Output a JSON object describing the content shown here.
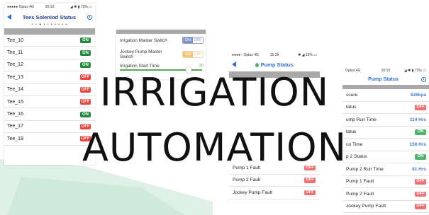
{
  "colors": {
    "on": "#1e8b3a",
    "off": "#f0423c",
    "accent": "#2d6fd6",
    "mint": "#dff1e6"
  },
  "headline": {
    "line1": "IRRIGATION",
    "line2": "AUTOMATION"
  },
  "screen1": {
    "status": {
      "carrier": "●●●●● Optus  4G",
      "time": "20:10",
      "battery": "◢ ✱ ▮ 73% ▭"
    },
    "title": "Tees Soleniod Status",
    "icons": {
      "back": "back-arrow-icon",
      "refresh": "clock-icon"
    },
    "page_dots": "• • ● • • • • • • •",
    "rows": [
      {
        "label": "Tee_10",
        "state": "ON"
      },
      {
        "label": "Tee_11",
        "state": "ON"
      },
      {
        "label": "Tee_12",
        "state": "ON"
      },
      {
        "label": "Tee_13",
        "state": "OFF"
      },
      {
        "label": "Tee_14",
        "state": "OFF"
      },
      {
        "label": "Tee_15",
        "state": "OFF"
      },
      {
        "label": "Tee_16",
        "state": "ON"
      },
      {
        "label": "Tee_17",
        "state": "OFF"
      },
      {
        "label": "Tee_18",
        "state": "OFF"
      }
    ]
  },
  "screen2": {
    "irrigation_master_switch": {
      "label": "Irrigation Master Switch",
      "on": "ON",
      "off": "OFF"
    },
    "jockey_pump_master_switch": {
      "label": "Jockey Pump Master Switch",
      "on": "ON",
      "off": "OFF"
    },
    "irrigation_start_time": {
      "label": "Irrigation Start Time",
      "value": "20"
    }
  },
  "screen3": {
    "status": {
      "carrier": "●●●●○ Optus  4G",
      "time": "15:39",
      "battery": "✱ ◢ 16% ▭"
    },
    "title": "Pump Status",
    "icons": {
      "back": "back-arrow-icon",
      "drop": "water-drop-icon",
      "refresh": "clock-icon"
    },
    "rows": [
      {
        "label": "Pump 1 Fault",
        "state": "OFF"
      },
      {
        "label": "Pump 2 Fault",
        "state": "OFF"
      },
      {
        "label": "Jockey Pump Fault",
        "state": "OFF"
      }
    ]
  },
  "screen4": {
    "status": {
      "carrier": "Optus  4G",
      "time": "20:10",
      "battery": "◢ ✱ ▮ 73% ▭"
    },
    "title": "Pump Status",
    "rows": [
      {
        "label": "ssure",
        "value": "626kpa",
        "kind": "value"
      },
      {
        "label": "tatus",
        "state": "OFF",
        "kind": "badge"
      },
      {
        "label": "ump Run Time",
        "value": "114 Hrs",
        "kind": "value"
      },
      {
        "label": "tatus",
        "state": "ON",
        "kind": "badge"
      },
      {
        "label": "un Time",
        "value": "156 Hrs",
        "kind": "value"
      },
      {
        "label": "p 2 Status",
        "state": "ON",
        "kind": "badge"
      },
      {
        "label": "Pump 2 Run Time",
        "value": "81 Hrs",
        "kind": "value"
      },
      {
        "label": "Pump 1 Fault",
        "state": "OFF",
        "kind": "badge"
      },
      {
        "label": "Pump 2 Fault",
        "state": "OFF",
        "kind": "badge"
      },
      {
        "label": "Jockey Pump Fault",
        "state": "OFF",
        "kind": "badge"
      }
    ]
  }
}
